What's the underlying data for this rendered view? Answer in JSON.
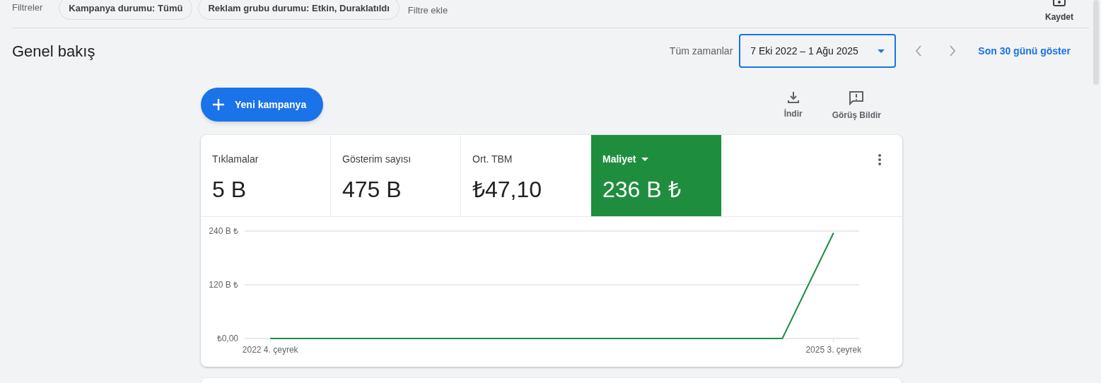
{
  "filters": {
    "label": "Filtreler",
    "chips": [
      "Kampanya durumu: Tümü",
      "Reklam grubu durumu: Etkin, Duraklatıldı"
    ],
    "add": "Filtre ekle"
  },
  "save": {
    "label": "Kaydet"
  },
  "header": {
    "title": "Genel bakış",
    "range_label": "Tüm zamanlar",
    "date_range": "7 Eki 2022 – 1 Ağu 2025",
    "prev_disabled": true,
    "next_disabled": true,
    "link": "Son 30 günü göster"
  },
  "new_campaign": "Yeni kampanya",
  "actions": [
    {
      "kind": "download",
      "label": "İndir"
    },
    {
      "kind": "feedback",
      "label": "Görüş Bildir"
    }
  ],
  "metrics": [
    {
      "label": "Tıklamalar",
      "value": "5 B",
      "selected": false
    },
    {
      "label": "Gösterim sayısı",
      "value": "475 B",
      "selected": false
    },
    {
      "label": "Ort. TBM",
      "value": "₺47,10",
      "selected": false
    },
    {
      "label": "Maliyet",
      "value": "236 B ₺",
      "selected": true
    }
  ],
  "chart_data": {
    "type": "line",
    "categories": [
      "2022 4. çeyrek",
      null,
      null,
      null,
      null,
      null,
      null,
      null,
      null,
      null,
      null,
      "2025 3. çeyrek"
    ],
    "ylim": [
      0,
      240
    ],
    "yticks": [
      {
        "value": 0,
        "label": "₺0,00"
      },
      {
        "value": 120,
        "label": "120 B ₺"
      },
      {
        "value": 240,
        "label": "240 B ₺"
      }
    ],
    "series": [
      {
        "color": "#1e8e3e",
        "values": [
          0,
          0,
          0,
          0,
          0,
          0,
          0,
          0,
          0,
          0,
          0,
          236
        ]
      }
    ]
  }
}
